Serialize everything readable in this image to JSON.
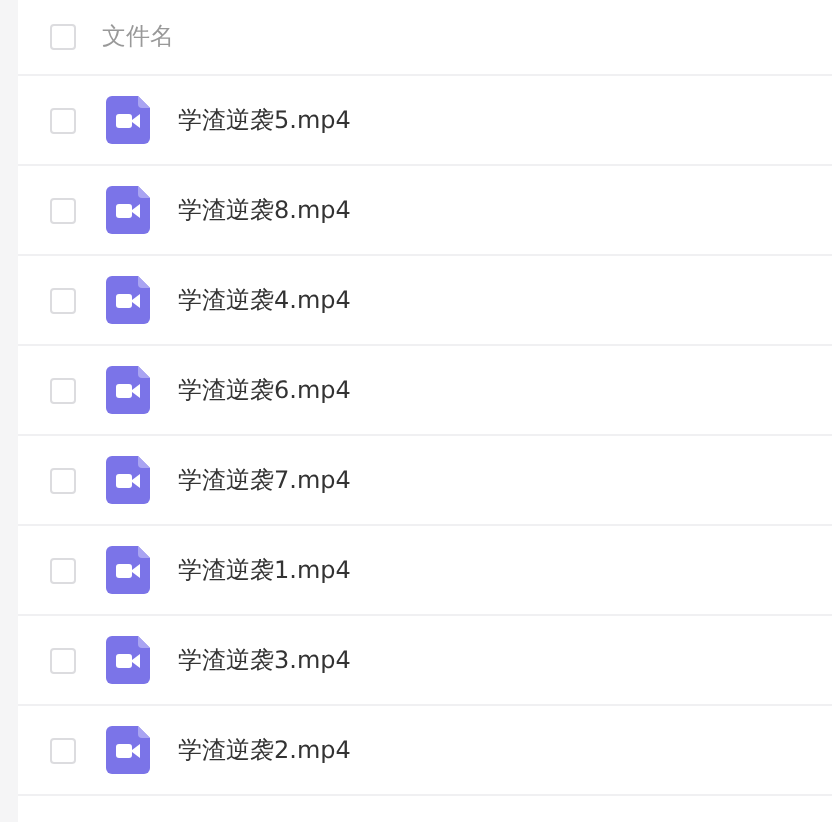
{
  "header": {
    "checked": false,
    "column_label": "文件名"
  },
  "files": [
    {
      "name": "学渣逆袭5.mp4",
      "checked": false
    },
    {
      "name": "学渣逆袭8.mp4",
      "checked": false
    },
    {
      "name": "学渣逆袭4.mp4",
      "checked": false
    },
    {
      "name": "学渣逆袭6.mp4",
      "checked": false
    },
    {
      "name": "学渣逆袭7.mp4",
      "checked": false
    },
    {
      "name": "学渣逆袭1.mp4",
      "checked": false
    },
    {
      "name": "学渣逆袭3.mp4",
      "checked": false
    },
    {
      "name": "学渣逆袭2.mp4",
      "checked": false
    }
  ]
}
